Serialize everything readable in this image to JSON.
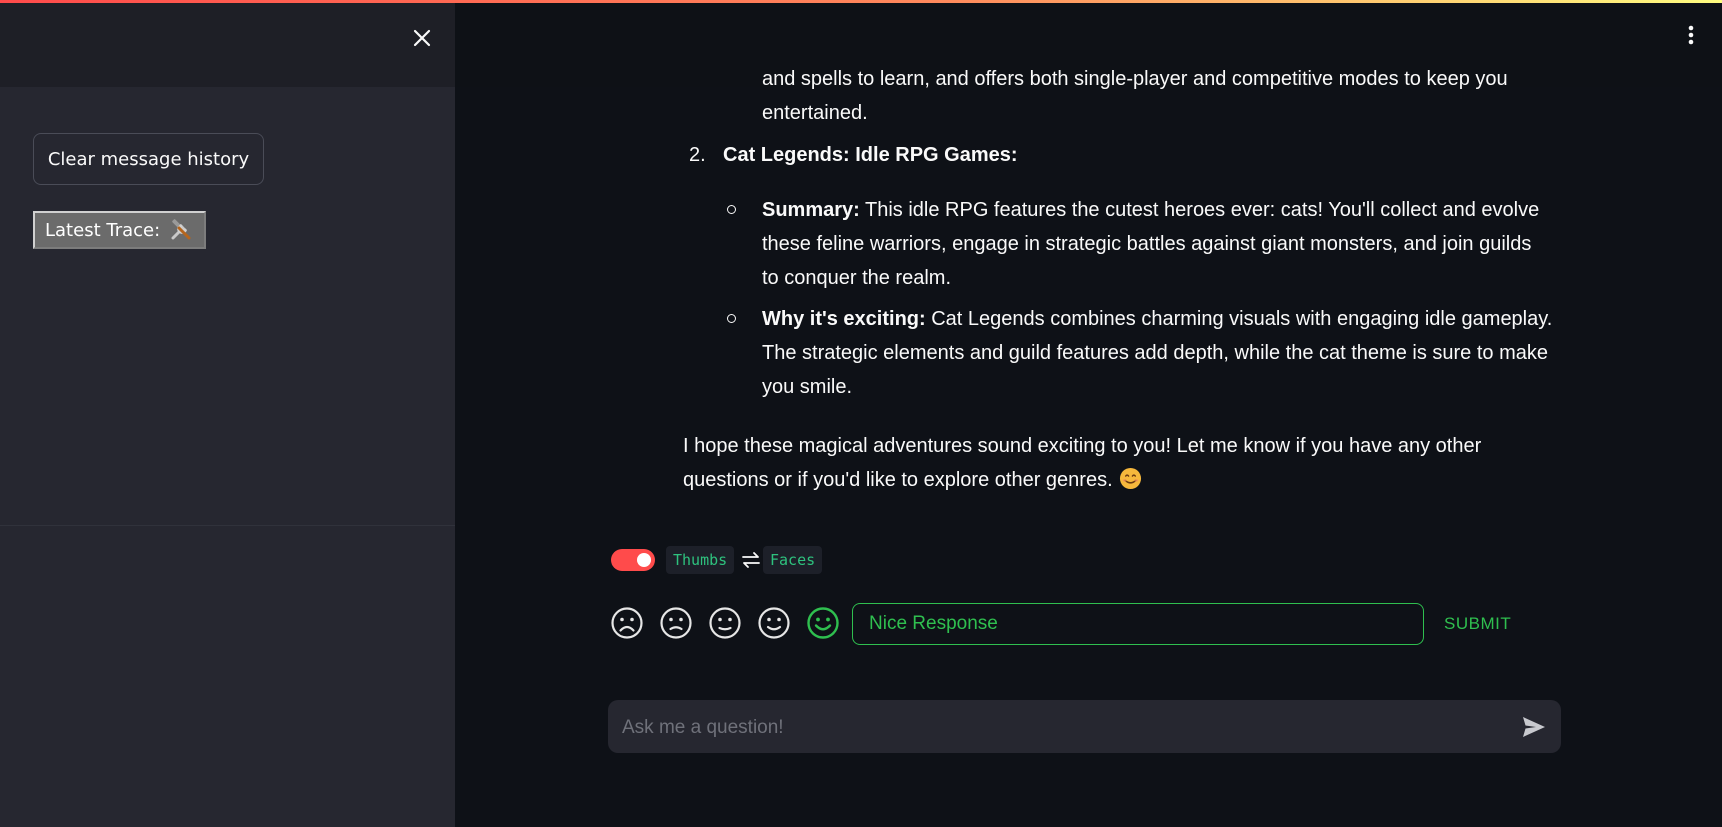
{
  "sidebar": {
    "close_icon": "close-icon",
    "clear_button_label": "Clear message history",
    "trace_button_label": "Latest Trace:",
    "trace_icon": "tools-icon"
  },
  "header": {
    "menu_icon": "vertical-ellipsis-icon"
  },
  "message": {
    "line_top1": "and spells to learn, and offers both single-player and competitive modes to keep you",
    "line_top2": "entertained.",
    "item2_number": "2.",
    "item2_title": "Cat Legends: Idle RPG Games:",
    "summary_label": "Summary:",
    "summary_line1": " This idle RPG features the cutest heroes ever: cats! You'll collect and evolve",
    "summary_line2": "these feline warriors, engage in strategic battles against giant monsters, and join guilds",
    "summary_line3": "to conquer the realm.",
    "why_label": "Why it's exciting:",
    "why_line1": " Cat Legends combines charming visuals with engaging idle gameplay.",
    "why_line2": "The strategic elements and guild features add depth, while the cat theme is sure to make",
    "why_line3": "you smile.",
    "closing_line1": "I hope these magical adventures sound exciting to you! Let me know if you have any other",
    "closing_line2": "questions or if you'd like to explore other genres.",
    "closing_emoji": "smiling-face-emoji"
  },
  "feedback": {
    "toggle_on": true,
    "thumbs_label": "Thumbs",
    "swap_icon": "swap-arrows-icon",
    "faces_label": "Faces",
    "faces": [
      "frowning-face-icon",
      "slightly-frowning-face-icon",
      "neutral-face-icon",
      "slightly-smiling-face-icon",
      "smiling-face-icon"
    ],
    "selected_face_index": 4,
    "accent_color": "#2fbf4f",
    "input_value": "Nice Response",
    "submit_label": "SUBMIT"
  },
  "chat": {
    "placeholder": "Ask me a question!",
    "send_icon": "send-icon"
  },
  "colors": {
    "background": "#0e1117",
    "sidebar": "#262730",
    "toggle": "#ff4b4b",
    "text": "#fafafa"
  }
}
